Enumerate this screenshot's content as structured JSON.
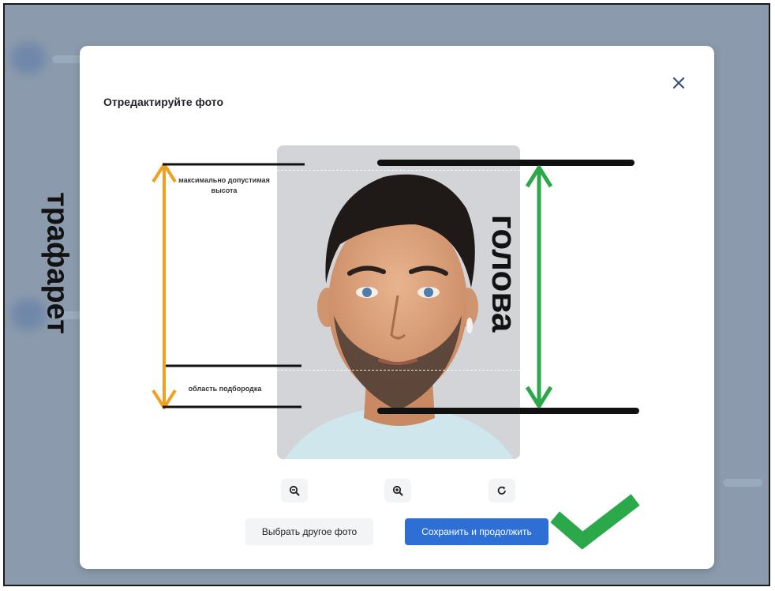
{
  "dialog": {
    "title": "Отредактируйте фото",
    "close_icon": "close-icon"
  },
  "photo_controls": [
    {
      "name": "zoom-out-button",
      "icon": "zoom-out-icon"
    },
    {
      "name": "zoom-in-button",
      "icon": "zoom-in-icon"
    },
    {
      "name": "rotate-button",
      "icon": "rotate-icon"
    }
  ],
  "buttons": {
    "choose_other": "Выбрать другое фото",
    "save_continue": "Сохранить и продолжить"
  },
  "annotations": {
    "stencil_label": "трафарет",
    "head_label": "голова",
    "max_height_label": "максимально допустимая высота",
    "chin_area_label": "область подбородка",
    "checkmark_icon": "checkmark-icon"
  },
  "colors": {
    "primary_button": "#2d6fd4",
    "stencil_arrow": "#f0a020",
    "head_arrow": "#2aa84a",
    "checkmark": "#2aa84a"
  }
}
